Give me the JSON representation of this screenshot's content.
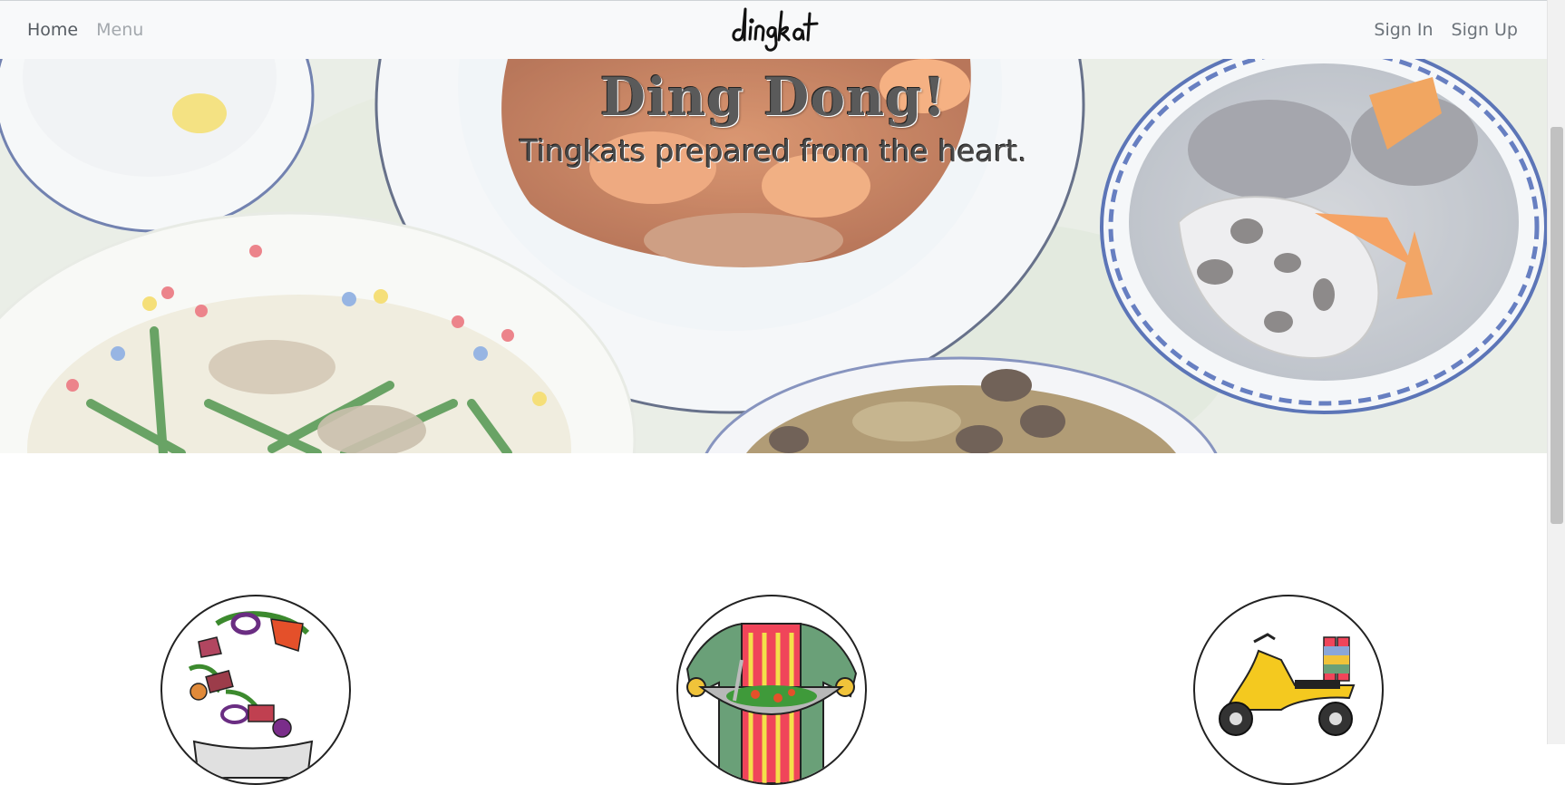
{
  "nav": {
    "home": "Home",
    "menu": "Menu",
    "brand": "dingkat",
    "sign_in": "Sign In",
    "sign_up": "Sign Up"
  },
  "hero": {
    "title": "Ding Dong!",
    "subtitle": "Tingkats prepared from the heart."
  },
  "features": [
    {
      "icon": "vegetables-ingredients-icon"
    },
    {
      "icon": "chef-holding-wok-icon"
    },
    {
      "icon": "scooter-delivery-icon"
    }
  ],
  "colors": {
    "navbar_bg": "#f8f9fa",
    "link_muted": "#a3a8ad",
    "link_default": "#555b61"
  }
}
